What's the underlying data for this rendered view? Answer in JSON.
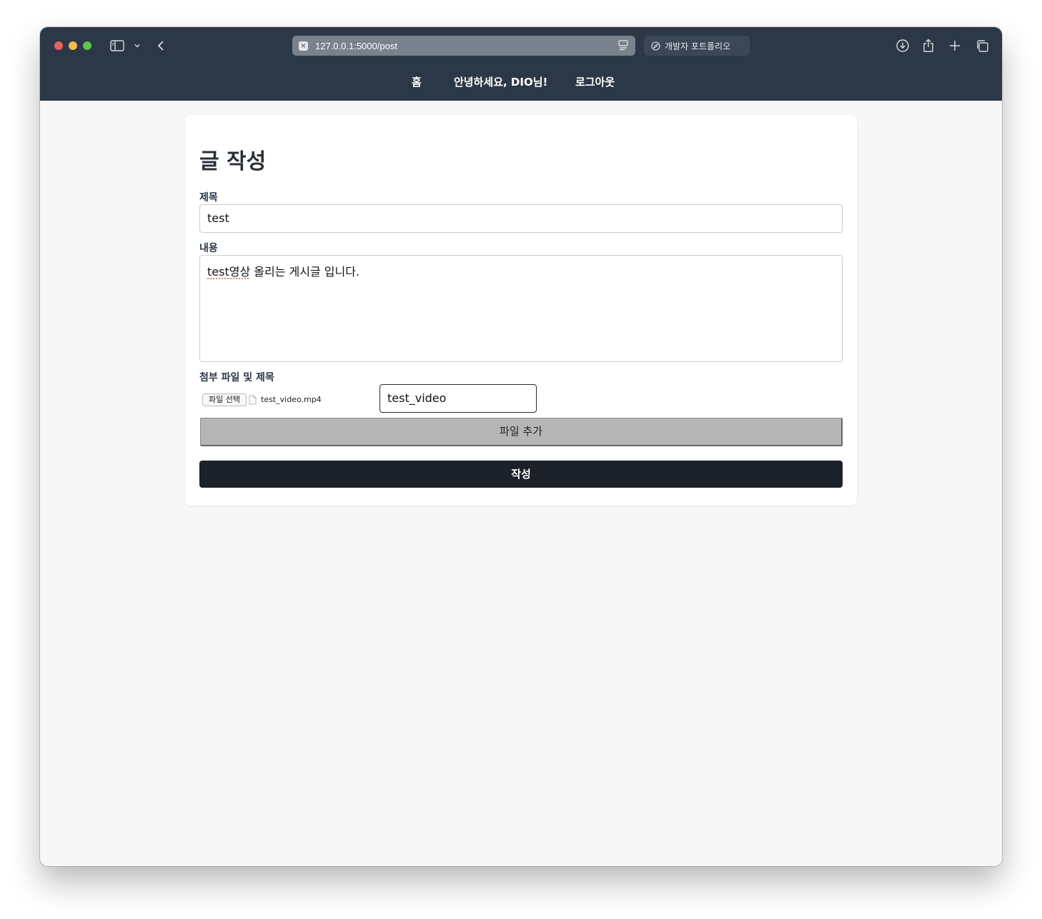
{
  "browser": {
    "url": "127.0.0.1:5000/post",
    "tab_title": "개발자 포트폴리오"
  },
  "nav": {
    "home": "홈",
    "greeting": "안녕하세요, DIO님!",
    "logout": "로그아웃"
  },
  "form": {
    "title": "글 작성",
    "subject_label": "제목",
    "subject_value": "test",
    "content_label": "내용",
    "content_value_spell": "test영상",
    "content_value_rest": " 올리는 게시글 입니다.",
    "attachment_label": "첨부 파일 및 제목",
    "file_button": "파일 선택",
    "file_name": "test_video.mp4",
    "file_title_value": "test_video",
    "add_file_button": "파일 추가",
    "submit_button": "작성"
  },
  "colors": {
    "header_bg": "#2c3747",
    "submit_bg": "#1d2129",
    "page_bg": "#f7f7f7"
  },
  "icons": [
    "sidebar-icon",
    "chevron-down-icon",
    "back-icon",
    "reader-icon",
    "compass-icon",
    "download-icon",
    "share-icon",
    "new-tab-icon",
    "tabs-overview-icon"
  ]
}
